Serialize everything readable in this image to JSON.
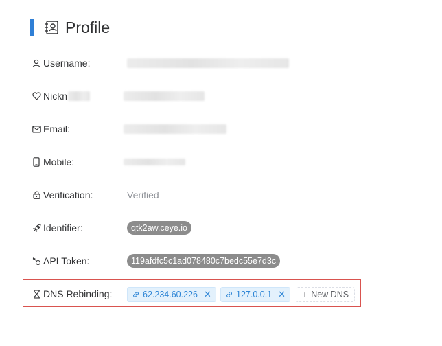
{
  "header": {
    "title": "Profile",
    "icon": "profile-card-icon"
  },
  "fields": {
    "username": {
      "label": "Username:",
      "icon": "user-icon"
    },
    "nickname": {
      "label": "Nickn",
      "icon": "heart-icon"
    },
    "email": {
      "label": "Email:",
      "icon": "mail-icon"
    },
    "mobile": {
      "label": "Mobile:",
      "icon": "mobile-icon"
    },
    "verification": {
      "label": "Verification:",
      "value": "Verified",
      "icon": "lock-icon"
    },
    "identifier": {
      "label": "Identifier:",
      "value": "qtk2aw.ceye.io",
      "icon": "rocket-icon"
    },
    "api_token": {
      "label": "API Token:",
      "value": "119afdfc5c1ad078480c7bedc55e7d3c",
      "icon": "key-icon"
    },
    "dns_rebinding": {
      "label": "DNS Rebinding:",
      "icon": "hourglass-icon",
      "entries": [
        "62.234.60.226",
        "127.0.0.1"
      ],
      "new_label": "New DNS"
    }
  },
  "colors": {
    "accent": "#2f7fd6",
    "tag_bg": "#e3f1fc",
    "tag_text": "#2f86d6",
    "pill_bg": "#8c8c8c",
    "highlight_border": "#d9534f"
  }
}
